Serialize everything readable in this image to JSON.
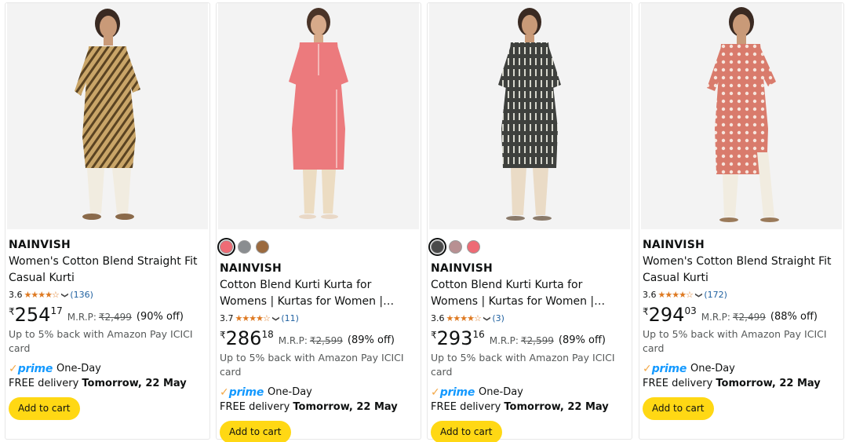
{
  "products": [
    {
      "swatches": [],
      "brand": "NAINVISH",
      "title": "Women's Cotton Blend Straight Fit Casual Kurti",
      "rating": "3.6",
      "stars": "★★★★☆",
      "reviews": "(136)",
      "currency": "₹",
      "price_whole": "254",
      "price_fraction": "17",
      "mrp_label": "M.R.P:",
      "mrp": "₹2,499",
      "discount": "(90% off)",
      "cashback": "Up to 5% back with Amazon Pay ICICI card",
      "prime_check": "✓",
      "prime": "prime",
      "prime_speed": "One-Day",
      "delivery_prefix": "FREE delivery ",
      "delivery_date": "Tomorrow, 22 May",
      "cart_label": "Add to cart",
      "kurta_color": "#c9a568",
      "stripe_color": "#5a4322"
    },
    {
      "swatches": [
        {
          "name": "coral",
          "color": "#ee6b75",
          "selected": true
        },
        {
          "name": "grey",
          "color": "#8a8d90",
          "selected": false
        },
        {
          "name": "brown",
          "color": "#9b6a3f",
          "selected": false
        }
      ],
      "brand": "NAINVISH",
      "title": "Cotton Blend Kurti Kurta for Womens | Kurtas for Women | Womens Kurta…",
      "rating": "3.7",
      "stars": "★★★★☆",
      "reviews": "(11)",
      "currency": "₹",
      "price_whole": "286",
      "price_fraction": "18",
      "mrp_label": "M.R.P:",
      "mrp": "₹2,599",
      "discount": "(89% off)",
      "cashback": "Up to 5% back with Amazon Pay ICICI card",
      "prime_check": "✓",
      "prime": "prime",
      "prime_speed": "One-Day",
      "delivery_prefix": "FREE delivery ",
      "delivery_date": "Tomorrow, 22 May",
      "cart_label": "Add to cart",
      "kurta_color": "#ec7a7d",
      "stripe_color": "#f4b8b8"
    },
    {
      "swatches": [
        {
          "name": "black",
          "color": "#4a4a4a",
          "selected": true
        },
        {
          "name": "mauve",
          "color": "#b89092",
          "selected": false
        },
        {
          "name": "coral",
          "color": "#ee6b75",
          "selected": false
        }
      ],
      "brand": "NAINVISH",
      "title": "Cotton Blend Kurti Kurta for Womens | Kurtas for Women | Womens Kurta…",
      "rating": "3.6",
      "stars": "★★★★☆",
      "reviews": "(3)",
      "currency": "₹",
      "price_whole": "293",
      "price_fraction": "16",
      "mrp_label": "M.R.P:",
      "mrp": "₹2,599",
      "discount": "(89% off)",
      "cashback": "Up to 5% back with Amazon Pay ICICI card",
      "prime_check": "✓",
      "prime": "prime",
      "prime_speed": "One-Day",
      "delivery_prefix": "FREE delivery ",
      "delivery_date": "Tomorrow, 22 May",
      "cart_label": "Add to cart",
      "kurta_color": "#3e403d",
      "stripe_color": "#d6d6cc"
    },
    {
      "swatches": [],
      "brand": "NAINVISH",
      "title": "Women's Cotton Blend Straight Fit Casual Kurti",
      "rating": "3.6",
      "stars": "★★★★☆",
      "reviews": "(172)",
      "currency": "₹",
      "price_whole": "294",
      "price_fraction": "03",
      "mrp_label": "M.R.P:",
      "mrp": "₹2,499",
      "discount": "(88% off)",
      "cashback": "Up to 5% back with Amazon Pay ICICI card",
      "prime_check": "✓",
      "prime": "prime",
      "prime_speed": "One-Day",
      "delivery_prefix": "FREE delivery ",
      "delivery_date": "Tomorrow, 22 May",
      "cart_label": "Add to cart",
      "kurta_color": "#d97b6c",
      "stripe_color": "#f6e5dd"
    }
  ]
}
